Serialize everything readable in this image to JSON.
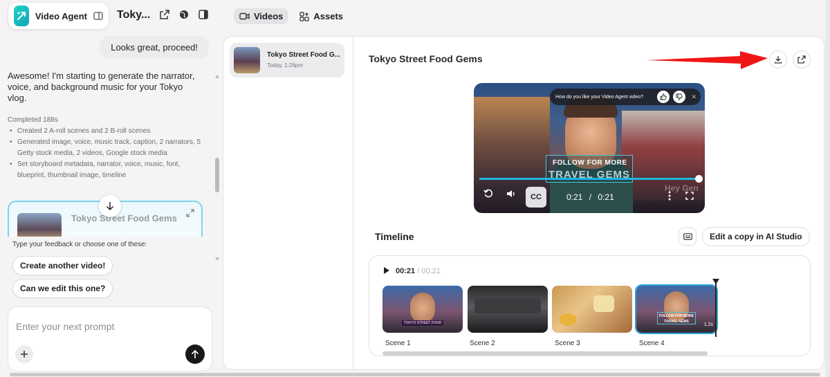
{
  "brand": {
    "name": "Video Agent"
  },
  "header": {
    "project_title": "Toky...",
    "tabs": [
      {
        "label": "Videos"
      },
      {
        "label": "Assets"
      }
    ]
  },
  "chat": {
    "user_message": "Looks great, proceed!",
    "assistant_message": "Awesome! I'm starting to generate the narrator, voice, and background music for your Tokyo vlog.",
    "completed_label": "Completed 188s",
    "tasks": [
      "Created 2 A-roll scenes and 2 B-roll scenes",
      "Generated image, voice, music track, caption, 2 narrators, 5 Getty stock media, 2 videos, Google stock media",
      "Set storyboard metadata, narrator, voice, music, font, blueprint, thumbnail image, timeline"
    ],
    "video_card_title": "Tokyo Street Food Gems",
    "feedback_prompt": "Type your feedback or choose one of these:",
    "suggestions": [
      "Create another video!",
      "Can we edit this one?"
    ],
    "input_placeholder": "Enter your next prompt"
  },
  "video_list": [
    {
      "title": "Tokyo Street Food G...",
      "date": "Today, 1:26pm"
    }
  ],
  "video_detail": {
    "title": "Tokyo Street Food Gems",
    "player": {
      "feedback_question": "How do you like your Video Agent video?",
      "caption_line1": "FOLLOW FOR MORE",
      "caption_line2": "TRAVEL GEMS",
      "cc_label": "CC",
      "current_time": "0:21",
      "separator": "/",
      "total_time": "0:21",
      "progress": 1.0,
      "watermark": "Hey Gen"
    }
  },
  "timeline": {
    "title": "Timeline",
    "edit_button": "Edit a copy in AI Studio",
    "current_time": "00:21",
    "separator": "/",
    "total_time": "00:21",
    "scenes": [
      {
        "label": "Scene 1",
        "caption": "TOKYO STREET FOOD"
      },
      {
        "label": "Scene 2"
      },
      {
        "label": "Scene 3"
      },
      {
        "label": "Scene 4",
        "caption": "FOLLOW FOR MORE TRAVEL GEMS",
        "duration": "1.2s"
      }
    ]
  },
  "colors": {
    "accent": "#1fb6e0",
    "brand": "#22d3c5",
    "annotation": "#ff0000"
  }
}
